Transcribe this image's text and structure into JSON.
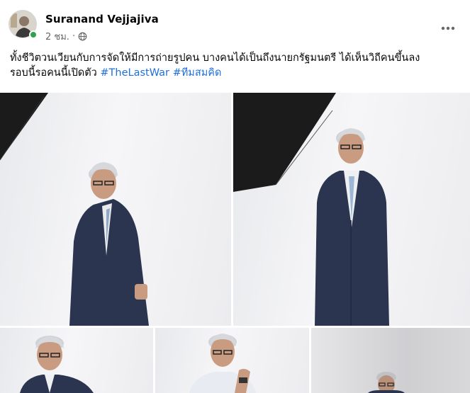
{
  "post": {
    "author": "Suranand Vejjajiva",
    "timestamp": "2 ชม.",
    "privacy_icon": "globe-icon",
    "more_icon": "more-horizontal-icon",
    "caption_line1": "ทั้งชีวิตวนเวียนกับการจัดให้มีการถ่ายรูปคน บางคนได้เป็นถึงนายกรัฐมนตรี ได้เห็นวิถีคนขึ้นลง",
    "caption_line2": "รอบนี้รอคนนี้เปิดตัว",
    "hashtags": [
      "#TheLastWar",
      "#ทีมสมคิด"
    ]
  },
  "photos": [
    {
      "subject": "man-in-suit-leaning"
    },
    {
      "subject": "man-in-suit-standing"
    },
    {
      "subject": "man-in-suit-portrait"
    },
    {
      "subject": "man-in-shirt-portrait"
    },
    {
      "subject": "man-in-suit-distance"
    }
  ],
  "colors": {
    "suit": "#2b3550",
    "hashtag": "#216fdb",
    "umbrella": "#1b1b1b"
  }
}
